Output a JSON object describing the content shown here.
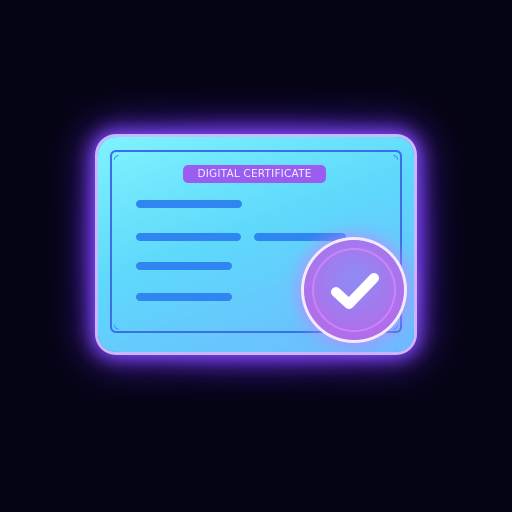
{
  "certificate": {
    "title": "DIGITAL CERTIFICATE",
    "status_icon": "checkmark-icon",
    "colors": {
      "card": "#5ed8fb",
      "lines": "#2f86f0",
      "pill": "#9a5df0",
      "glow": "#8a4dff",
      "background": "#050414"
    }
  }
}
